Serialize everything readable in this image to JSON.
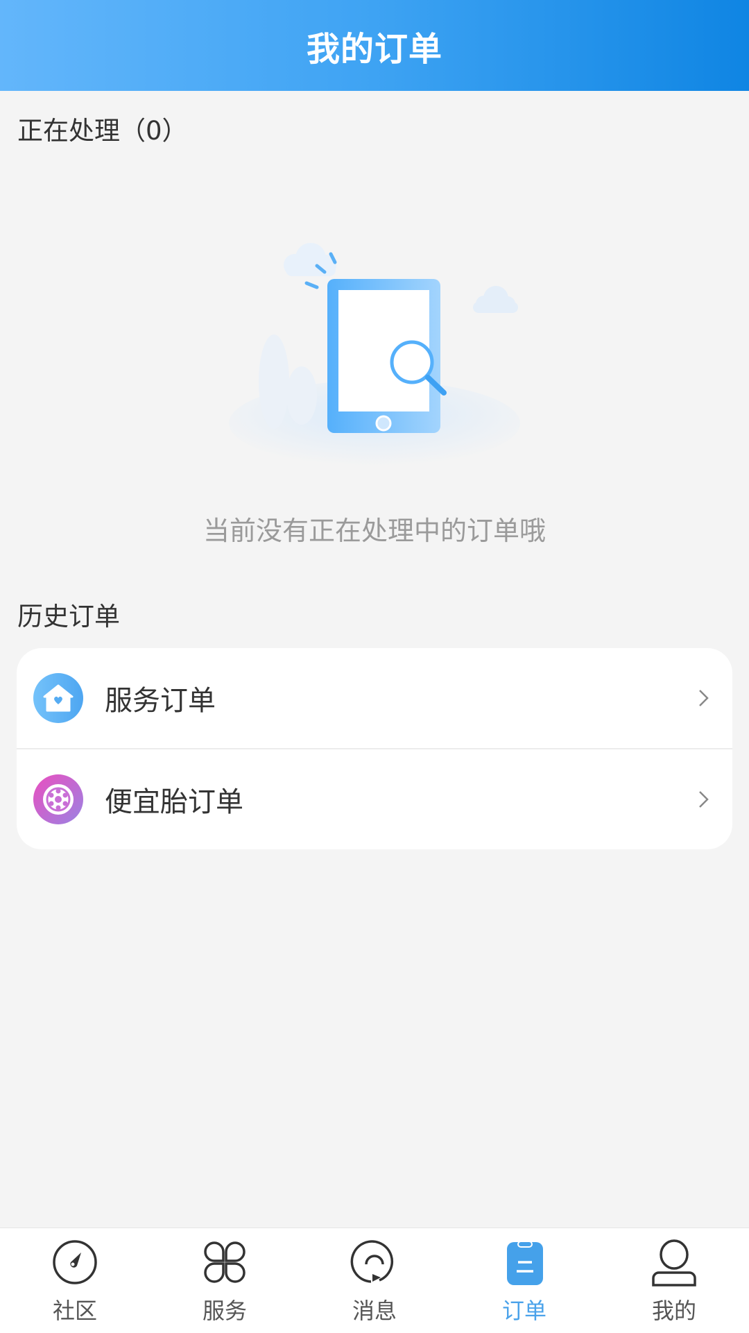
{
  "header": {
    "title": "我的订单"
  },
  "processing": {
    "title": "正在处理（0）",
    "count": 0,
    "empty_message": "当前没有正在处理中的订单哦",
    "illustration": "empty-orders-illustration"
  },
  "history": {
    "title": "历史订单",
    "items": [
      {
        "label": "服务订单",
        "icon": "house-heart-icon",
        "icon_colors": [
          "#74c2fa",
          "#4ea6f1"
        ]
      },
      {
        "label": "便宜胎订单",
        "icon": "tire-icon",
        "icon_colors": [
          "#ea4fbf",
          "#9a83e3"
        ]
      }
    ]
  },
  "tabbar": {
    "active_color": "#4aa2ea",
    "items": [
      {
        "label": "社区",
        "icon": "compass-icon",
        "active": false
      },
      {
        "label": "服务",
        "icon": "clover-grid-icon",
        "active": false
      },
      {
        "label": "消息",
        "icon": "chat-bubble-icon",
        "active": false
      },
      {
        "label": "订单",
        "icon": "clipboard-icon",
        "active": true
      },
      {
        "label": "我的",
        "icon": "person-icon",
        "active": false
      }
    ]
  }
}
